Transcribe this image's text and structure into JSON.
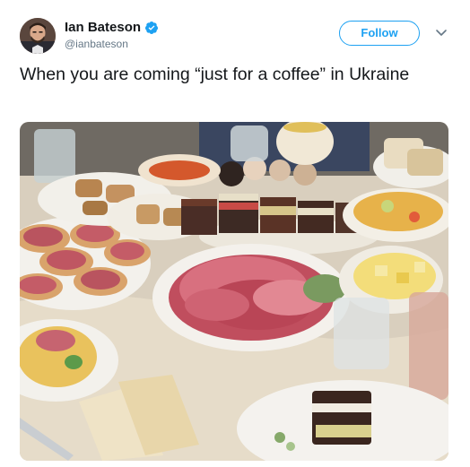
{
  "tweet": {
    "author": {
      "display_name": "Ian Bateson",
      "handle": "@ianbateson",
      "verified": true,
      "avatar_icon": "profile-photo"
    },
    "follow_label": "Follow",
    "menu_icon": "chevron-down-icon",
    "text": "When you are coming “just for a coffee” in Ukraine",
    "media": {
      "type": "photo",
      "icon": "photo-of-food-table"
    }
  },
  "colors": {
    "accent": "#1da1f2",
    "text_primary": "#14171a",
    "text_secondary": "#657786"
  }
}
